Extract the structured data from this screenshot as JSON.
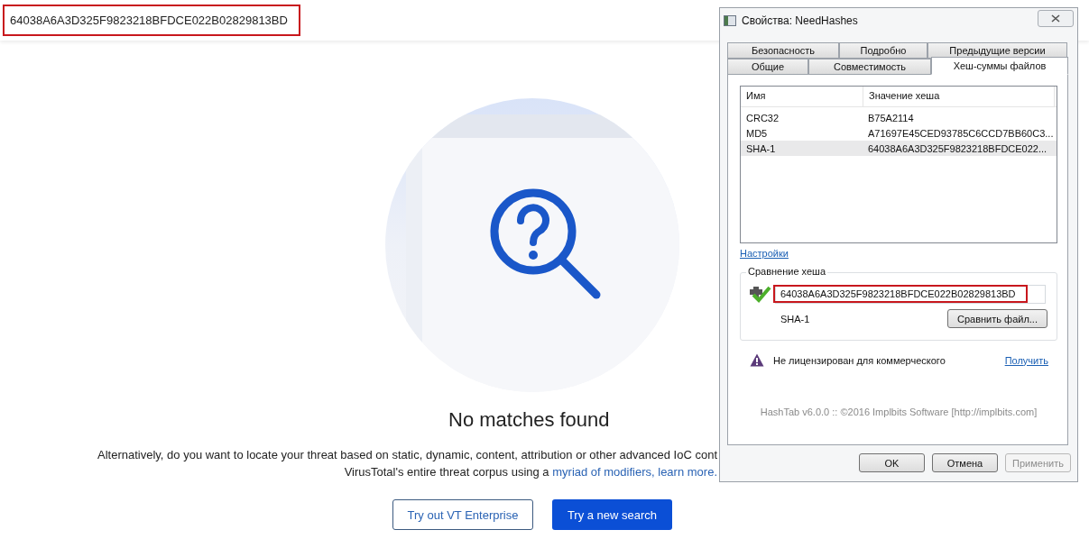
{
  "search_bar": {
    "value": "64038A6A3D325F9823218BFDCE022B02829813BD",
    "highlighted": true
  },
  "empty_state": {
    "title": "No matches found",
    "line_1": "Alternatively, do you want to locate your threat based on static, dynamic, content, attribution or other advanced IoC cont",
    "line_2": "VirusTotal's entire threat corpus using a ",
    "link": "myriad of modifiers, learn more.",
    "buttons": [
      {
        "label": "Try out VT Enterprise",
        "kind": "outline"
      },
      {
        "label": "Try a new search",
        "kind": "primary"
      }
    ]
  },
  "dialog": {
    "title": "Свойства: NeedHashes",
    "tab_rows": [
      [
        {
          "label": "Безопасность",
          "selected": false
        },
        {
          "label": "Подробно",
          "selected": false
        },
        {
          "label": "Предыдущие версии",
          "selected": false
        }
      ],
      [
        {
          "label": "Общие",
          "selected": false
        },
        {
          "label": "Совместимость",
          "selected": false
        },
        {
          "label": "Хеш-суммы файлов",
          "selected": true
        }
      ]
    ],
    "columns": [
      "Имя",
      "Значение хеша"
    ],
    "rows": [
      {
        "name": "CRC32",
        "value": "B75A2114",
        "selected": false
      },
      {
        "name": "MD5",
        "value": "A71697E45CED93785C6CCD7BB60C3...",
        "selected": false
      },
      {
        "name": "SHA-1",
        "value": "64038A6A3D325F9823218BFDCE022...",
        "selected": true
      }
    ],
    "settings_link": "Настройки",
    "compare": {
      "legend": "Сравнение хеша",
      "value": "64038A6A3D325F9823218BFDCE022B02829813BD",
      "highlighted": true,
      "match": true,
      "algorithm": "SHA-1",
      "button": "Сравнить файл..."
    },
    "license": {
      "text": "Не лицензирован для коммерческого",
      "link": "Получить"
    },
    "footer": "HashTab v6.0.0 :: ©2016 Implbits Software [http://implbits.com]",
    "buttons": [
      {
        "label": "OK",
        "disabled": false
      },
      {
        "label": "Отмена",
        "disabled": false
      },
      {
        "label": "Применить",
        "disabled": true
      }
    ]
  }
}
